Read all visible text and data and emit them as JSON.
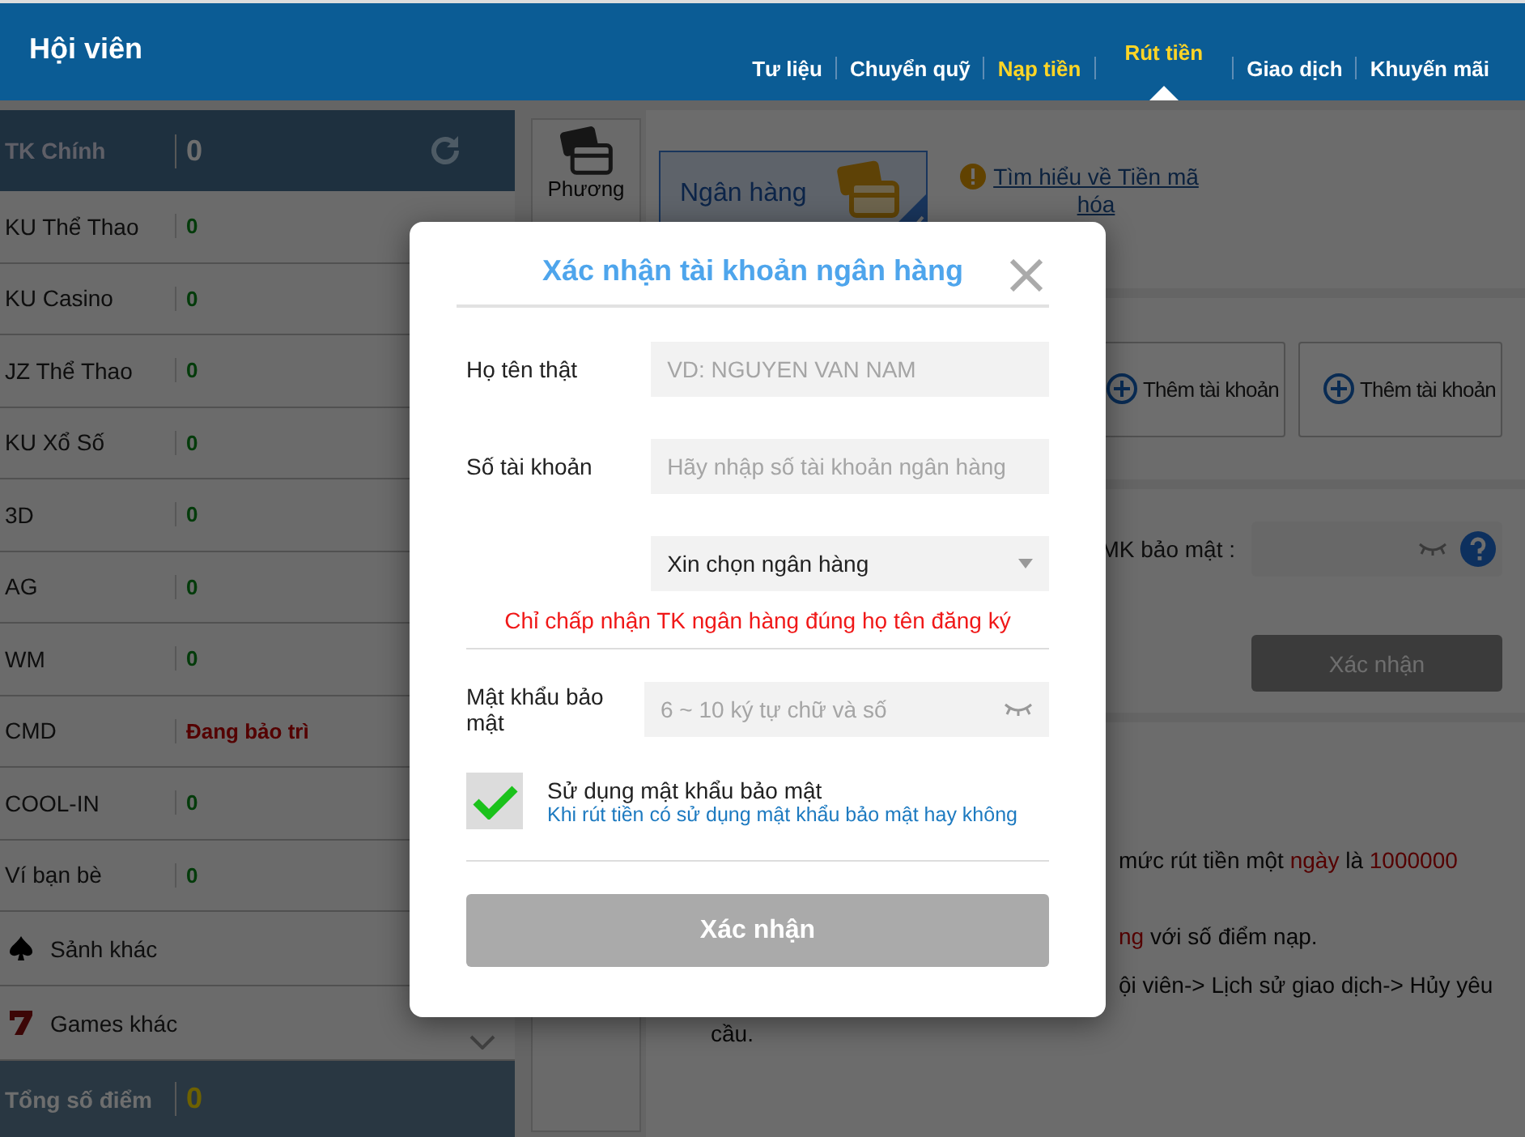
{
  "header": {
    "title": "Hội viên",
    "nav": [
      {
        "label": "Tư liệu",
        "selected": false,
        "highlight": false
      },
      {
        "label": "Chuyển quỹ",
        "selected": false,
        "highlight": false
      },
      {
        "label": "Nạp tiền",
        "selected": false,
        "highlight": true
      },
      {
        "label": "Rút tiền",
        "selected": true,
        "highlight": true
      },
      {
        "label": "Giao dịch",
        "selected": false,
        "highlight": false
      },
      {
        "label": "Khuyến mãi",
        "selected": false,
        "highlight": false
      }
    ]
  },
  "sidebar": {
    "main": {
      "label": "TK Chính",
      "value": "0"
    },
    "wallets": [
      {
        "label": "KU Thể Thao",
        "value": "0",
        "kind": "balance"
      },
      {
        "label": "KU Casino",
        "value": "0",
        "kind": "balance"
      },
      {
        "label": "JZ Thể Thao",
        "value": "0",
        "kind": "balance"
      },
      {
        "label": "KU Xổ Số",
        "value": "0",
        "kind": "balance"
      },
      {
        "label": "3D",
        "value": "0",
        "kind": "balance"
      },
      {
        "label": "AG",
        "value": "0",
        "kind": "balance"
      },
      {
        "label": "WM",
        "value": "0",
        "kind": "balance"
      },
      {
        "label": "CMD",
        "value": "Đang bảo trì",
        "kind": "maintenance"
      },
      {
        "label": "COOL-IN",
        "value": "0",
        "kind": "balance"
      },
      {
        "label": "Ví bạn bè",
        "value": "0",
        "kind": "balance"
      }
    ],
    "lobbies": [
      {
        "label": "Sảnh khác",
        "kind": "spade"
      },
      {
        "label": "Games khác",
        "kind": "seven"
      }
    ],
    "total": {
      "label": "Tổng số điểm",
      "value": "0"
    }
  },
  "methods": {
    "label": "Phương",
    "card": {
      "label": "Ngân hàng",
      "selected": true
    },
    "link": "Tìm hiểu về Tiền mã hóa"
  },
  "accounts": {
    "buttons": [
      "Thêm tài khoản",
      "Thêm tài khoản"
    ]
  },
  "security": {
    "label": "MK bảo mật :",
    "button": "Xác nhận"
  },
  "notes": [
    {
      "kind": "clipped",
      "segments": [
        {
          "text": "mức rút tiền một ",
          "highlight": false
        },
        {
          "text": "ngày",
          "highlight": true
        },
        {
          "text": " là ",
          "highlight": false
        },
        {
          "text": "1000000",
          "highlight": true
        }
      ]
    },
    {
      "kind": "clipped",
      "segments": [
        {
          "text": "ng",
          "highlight": true
        },
        {
          "text": " với số điểm nạp.",
          "highlight": false
        }
      ]
    },
    {
      "kind": "clipped",
      "segments": [
        {
          "text": "ội viên-> Lịch sử giao dịch-> Hủy yêu",
          "highlight": false
        }
      ]
    },
    {
      "kind": "continued",
      "segments": [
        {
          "text": "cầu.",
          "highlight": false
        }
      ]
    }
  ],
  "dialog": {
    "title": "Xác nhận tài khoản ngân hàng",
    "name": {
      "label": "Họ tên thật",
      "placeholder": "VD: NGUYEN VAN NAM"
    },
    "account": {
      "label": "Số tài khoản",
      "placeholder": "Hãy nhập số tài khoản ngân hàng"
    },
    "bank": {
      "value": "Xin chọn ngân hàng"
    },
    "warning": "Chỉ chấp nhận TK ngân hàng đúng họ tên đăng ký",
    "password": {
      "label": "Mật khẩu bảo mật",
      "placeholder": "6 ~ 10 ký tự chữ và số"
    },
    "use_password": {
      "checked": true,
      "label": "Sử dụng mật khẩu bảo mật",
      "hint": "Khi rút tiền có sử dụng mật khẩu bảo mật hay không"
    },
    "button": "Xác nhận"
  }
}
